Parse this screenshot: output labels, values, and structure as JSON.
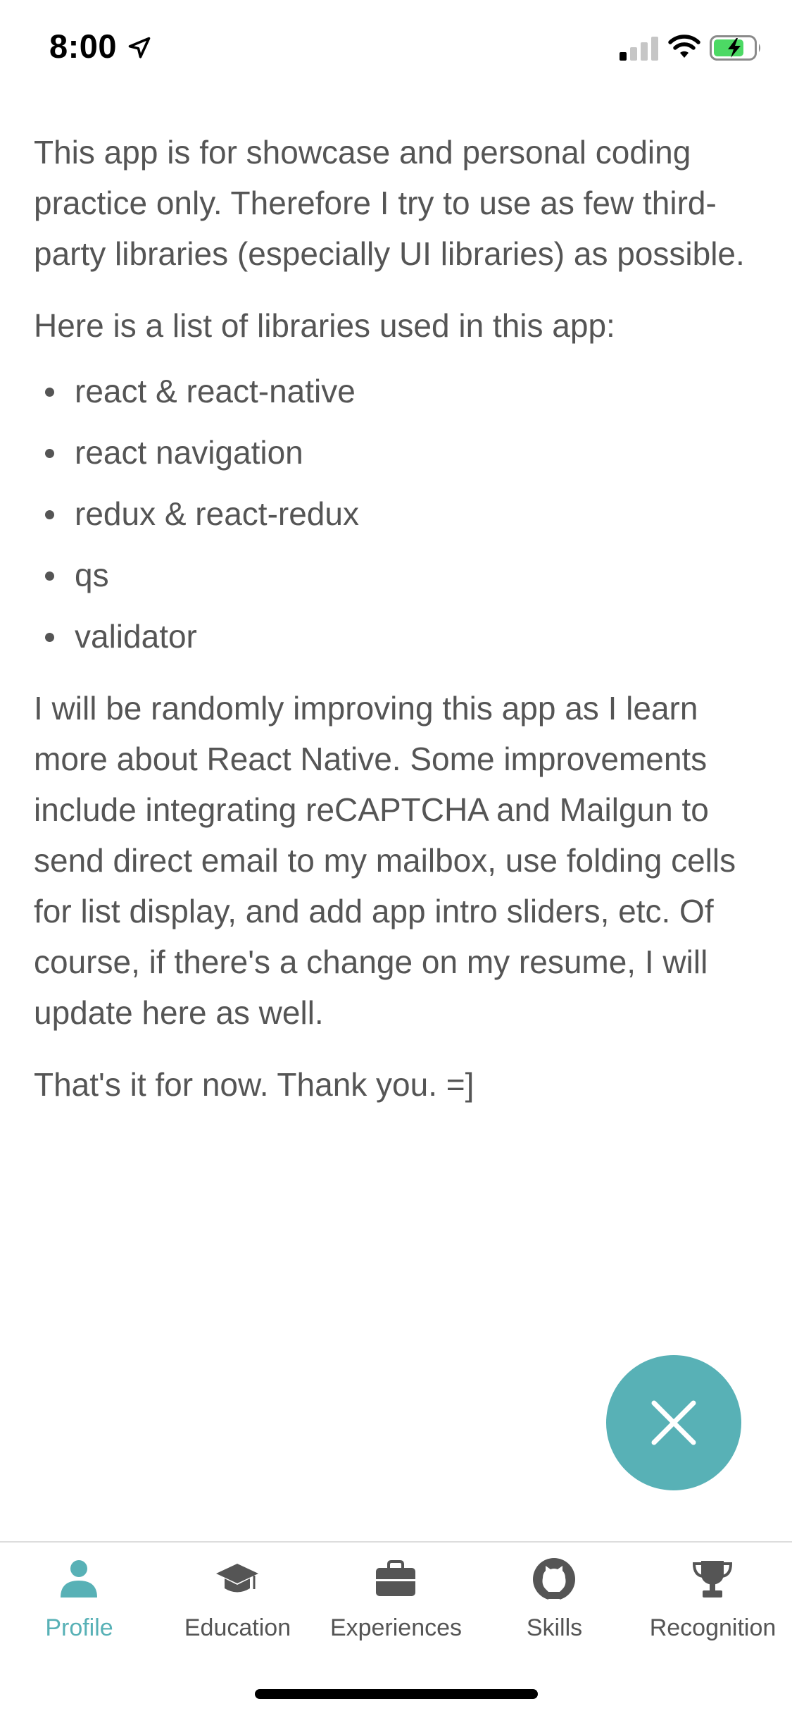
{
  "status_bar": {
    "time": "8:00",
    "icons": [
      "location-arrow-icon",
      "cellular-signal-icon",
      "wifi-icon",
      "battery-charging-icon"
    ]
  },
  "content": {
    "intro": "This app is for showcase and personal coding practice only. Therefore I try to use as few third-party libraries (especially UI libraries) as possible.",
    "list_intro": "Here is a list of libraries used in this app:",
    "libraries": [
      "react & react-native",
      "react navigation",
      "redux & react-redux",
      "qs",
      "validator"
    ],
    "improvements": "I will be randomly improving this app as I learn more about React Native. Some improvements include integrating reCAPTCHA and Mailgun to send direct email to my mailbox, use folding cells for list display, and add app intro sliders, etc. Of course, if there's a change on my resume, I will update here as well.",
    "closing": "That's it for now. Thank you. =]"
  },
  "fab": {
    "icon": "close-icon",
    "color": "#58b1b6"
  },
  "tab_bar": {
    "active_color": "#58b1b6",
    "inactive_color": "#555555",
    "tabs": [
      {
        "label": "Profile",
        "icon": "person-icon",
        "active": true
      },
      {
        "label": "Education",
        "icon": "graduation-cap-icon",
        "active": false
      },
      {
        "label": "Experiences",
        "icon": "briefcase-icon",
        "active": false
      },
      {
        "label": "Skills",
        "icon": "github-icon",
        "active": false
      },
      {
        "label": "Recognition",
        "icon": "trophy-icon",
        "active": false
      }
    ]
  }
}
